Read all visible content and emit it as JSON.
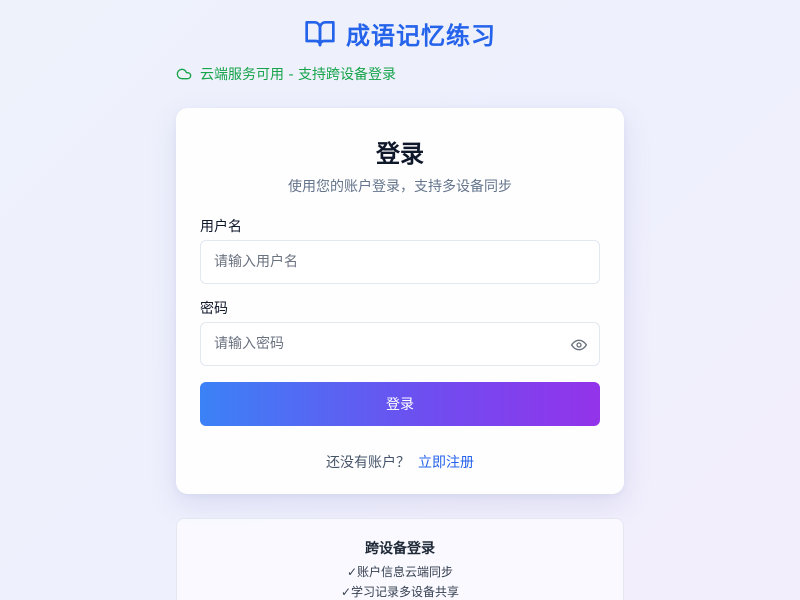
{
  "header": {
    "title": "成语记忆练习",
    "icon": "book-open-icon"
  },
  "status": {
    "icon": "cloud-icon",
    "text": "云端服务可用 - 支持跨设备登录",
    "color": "#16a34a"
  },
  "login": {
    "title": "登录",
    "subtitle": "使用您的账户登录，支持多设备同步",
    "username_label": "用户名",
    "username_placeholder": "请输入用户名",
    "username_value": "",
    "password_label": "密码",
    "password_placeholder": "请输入密码",
    "password_value": "",
    "password_toggle_icon": "eye-icon",
    "submit_label": "登录",
    "register_prompt": "还没有账户？",
    "register_link": "立即注册"
  },
  "info": {
    "title": "跨设备登录",
    "items": [
      "✓账户信息云端同步",
      "✓学习记录多设备共享"
    ]
  },
  "colors": {
    "accent": "#2563eb",
    "status": "#16a34a",
    "button_gradient_start": "#3b82f6",
    "button_gradient_end": "#9333ea"
  }
}
